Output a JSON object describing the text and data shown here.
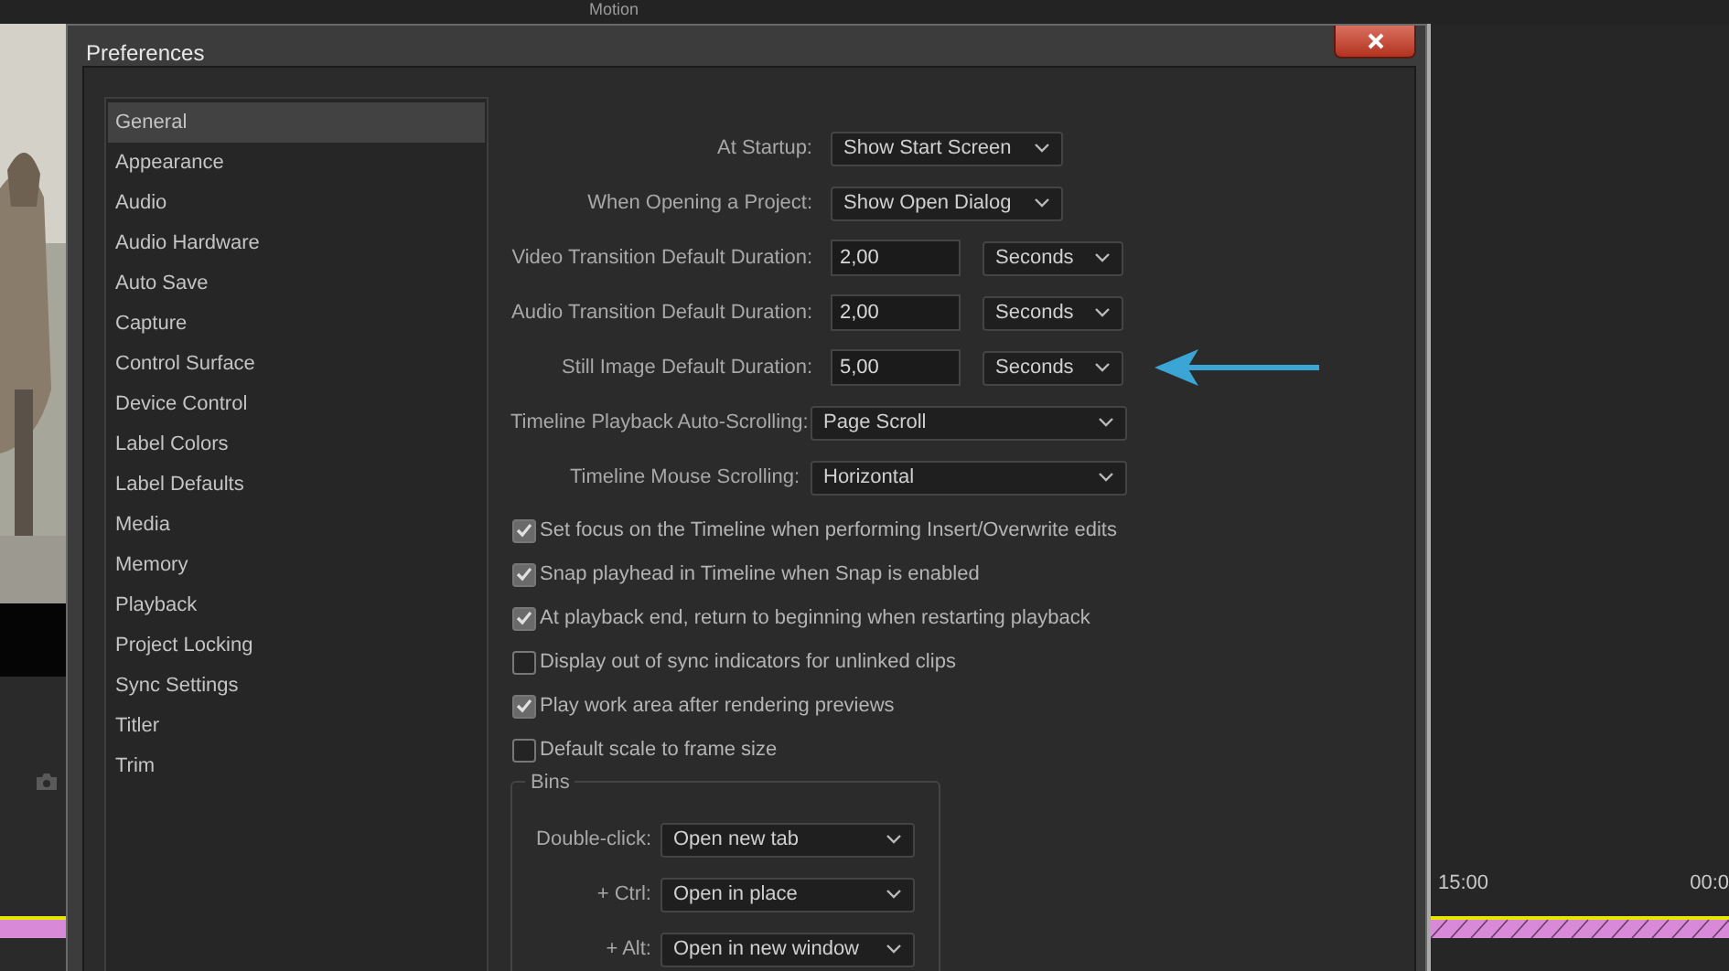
{
  "background": {
    "panel_title": "Motion",
    "timecodes": [
      "15:00",
      "00:0"
    ]
  },
  "window": {
    "title": "Preferences"
  },
  "sidebar": {
    "items": [
      {
        "label": "General",
        "selected": true
      },
      {
        "label": "Appearance",
        "selected": false
      },
      {
        "label": "Audio",
        "selected": false
      },
      {
        "label": "Audio Hardware",
        "selected": false
      },
      {
        "label": "Auto Save",
        "selected": false
      },
      {
        "label": "Capture",
        "selected": false
      },
      {
        "label": "Control Surface",
        "selected": false
      },
      {
        "label": "Device Control",
        "selected": false
      },
      {
        "label": "Label Colors",
        "selected": false
      },
      {
        "label": "Label Defaults",
        "selected": false
      },
      {
        "label": "Media",
        "selected": false
      },
      {
        "label": "Memory",
        "selected": false
      },
      {
        "label": "Playback",
        "selected": false
      },
      {
        "label": "Project Locking",
        "selected": false
      },
      {
        "label": "Sync Settings",
        "selected": false
      },
      {
        "label": "Titler",
        "selected": false
      },
      {
        "label": "Trim",
        "selected": false
      }
    ]
  },
  "settings": [
    {
      "kind": "dropdown",
      "label": "At Startup:",
      "value": "Show Start Screen"
    },
    {
      "kind": "dropdown",
      "label": "When Opening a Project:",
      "value": "Show Open Dialog"
    },
    {
      "kind": "duration",
      "label": "Video Transition Default Duration:",
      "value": "2,00",
      "unit": "Seconds"
    },
    {
      "kind": "duration",
      "label": "Audio Transition Default Duration:",
      "value": "2,00",
      "unit": "Seconds"
    },
    {
      "kind": "duration",
      "label": "Still Image Default Duration:",
      "value": "5,00",
      "unit": "Seconds",
      "pointed": true
    },
    {
      "kind": "wide",
      "label": "Timeline Playback Auto-Scrolling:",
      "value": "Page Scroll"
    },
    {
      "kind": "wide",
      "label": "Timeline Mouse Scrolling:",
      "value": "Horizontal"
    }
  ],
  "checkboxes": [
    {
      "label": "Set focus on the Timeline when performing Insert/Overwrite edits",
      "checked": true
    },
    {
      "label": "Snap playhead in Timeline when Snap is enabled",
      "checked": true
    },
    {
      "label": "At playback end, return to beginning when restarting playback",
      "checked": true
    },
    {
      "label": "Display out of sync indicators for unlinked clips",
      "checked": false
    },
    {
      "label": "Play work area after rendering previews",
      "checked": true
    },
    {
      "label": "Default scale to frame size",
      "checked": false
    }
  ],
  "bins": {
    "title": "Bins",
    "rows": [
      {
        "label": "Double-click:",
        "value": "Open new tab"
      },
      {
        "label": "+ Ctrl:",
        "value": "Open in place"
      },
      {
        "label": "+ Alt:",
        "value": "Open in new window"
      }
    ]
  }
}
